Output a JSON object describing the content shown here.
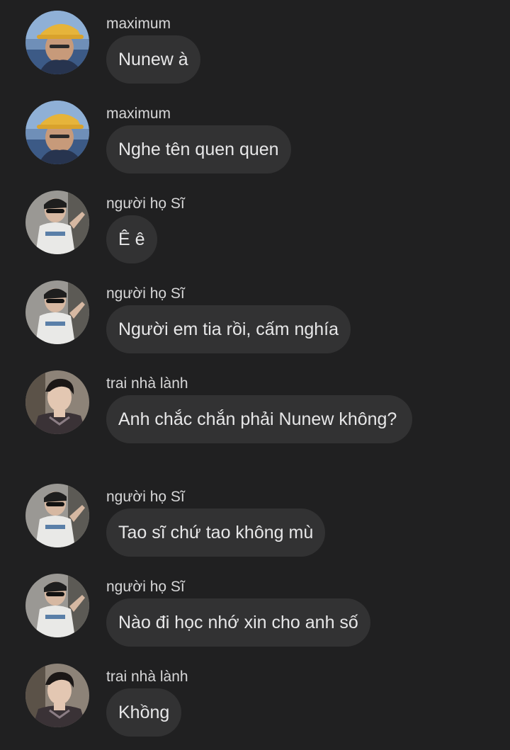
{
  "colors": {
    "background": "#202021",
    "bubble": "#323233",
    "sender_text": "#d7d7d8",
    "message_text": "#e7e7e8"
  },
  "messages": [
    {
      "sender": "maximum",
      "text": "Nunew à",
      "avatar": "maximum-avatar"
    },
    {
      "sender": "maximum",
      "text": "Nghe tên quen quen",
      "avatar": "maximum-avatar"
    },
    {
      "sender": "người họ Sĩ",
      "text": "Ê ê",
      "avatar": "nguoi-ho-si-avatar"
    },
    {
      "sender": "người họ Sĩ",
      "text": "Người em tia rồi, cấm nghía",
      "avatar": "nguoi-ho-si-avatar"
    },
    {
      "sender": "trai nhà lành",
      "text": "Anh chắc chắn phải Nunew không?",
      "avatar": "trai-nha-lanh-avatar"
    },
    {
      "sender": "người họ Sĩ",
      "text": "Tao sĩ chứ tao không mù",
      "avatar": "nguoi-ho-si-avatar"
    },
    {
      "sender": "người họ Sĩ",
      "text": "Nào đi học nhớ xin cho anh số",
      "avatar": "nguoi-ho-si-avatar"
    },
    {
      "sender": "trai nhà lành",
      "text": "Khồng",
      "avatar": "trai-nha-lanh-avatar"
    }
  ]
}
